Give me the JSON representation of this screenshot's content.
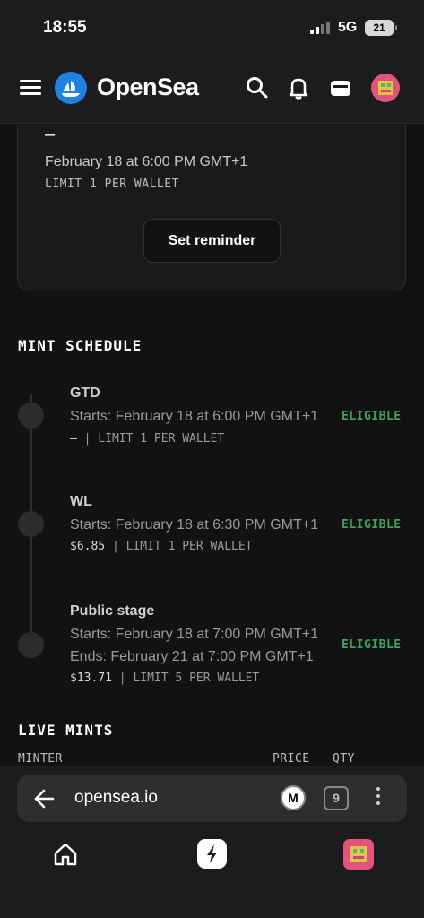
{
  "status_bar": {
    "time": "18:55",
    "network": "5G",
    "battery": "21"
  },
  "header": {
    "brand": "OpenSea"
  },
  "drop_card": {
    "price": "–",
    "date": "February 18 at 6:00 PM GMT+1",
    "limit": "LIMIT 1 PER WALLET",
    "reminder_button": "Set reminder"
  },
  "mint_schedule": {
    "title": "MINT SCHEDULE",
    "stages": [
      {
        "name": "GTD",
        "starts": "Starts: February 18 at 6:00 PM GMT+1",
        "ends": "",
        "price": "–",
        "limit": "| LIMIT 1 PER WALLET",
        "status": "ELIGIBLE"
      },
      {
        "name": "WL",
        "starts": "Starts: February 18 at 6:30 PM GMT+1",
        "ends": "",
        "price": "$6.85",
        "limit": "| LIMIT 1 PER WALLET",
        "status": "ELIGIBLE"
      },
      {
        "name": "Public stage",
        "starts": "Starts: February 18 at 7:00 PM GMT+1",
        "ends": "Ends: February 21 at 7:00 PM GMT+1",
        "price": "$13.71",
        "limit": "| LIMIT 5 PER WALLET",
        "status": "ELIGIBLE"
      }
    ]
  },
  "live_mints": {
    "title": "LIVE MINTS",
    "columns": [
      "MINTER",
      "PRICE",
      "QTY"
    ]
  },
  "browser": {
    "url": "opensea.io",
    "extension_label": "M",
    "tab_count": "9"
  },
  "colors": {
    "accent": "#2081e2",
    "eligible": "#3fa060",
    "background": "#121212"
  }
}
